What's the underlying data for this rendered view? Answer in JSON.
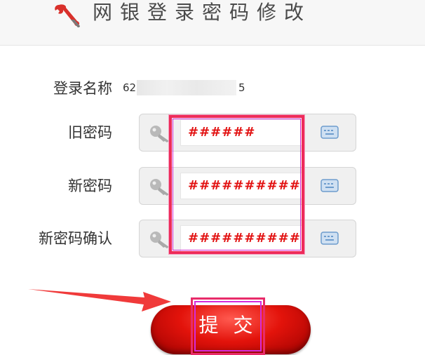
{
  "header": {
    "title": "网银登录密码修改",
    "icon": "wrench-icon"
  },
  "form": {
    "login_name_label": "登录名称",
    "login_name_start": "62",
    "login_name_end": "5",
    "old_password": {
      "label": "旧密码",
      "value": "######"
    },
    "new_password": {
      "label": "新密码",
      "value": "############"
    },
    "confirm_password": {
      "label": "新密码确认",
      "value": "############"
    }
  },
  "submit": {
    "label": "提 交"
  },
  "colors": {
    "password_text": "#e21111",
    "highlight_border": "#ee2b5a",
    "highlight_inner": "#d12bd4",
    "button": "#e3130b",
    "arrow": "#f03a3a"
  }
}
